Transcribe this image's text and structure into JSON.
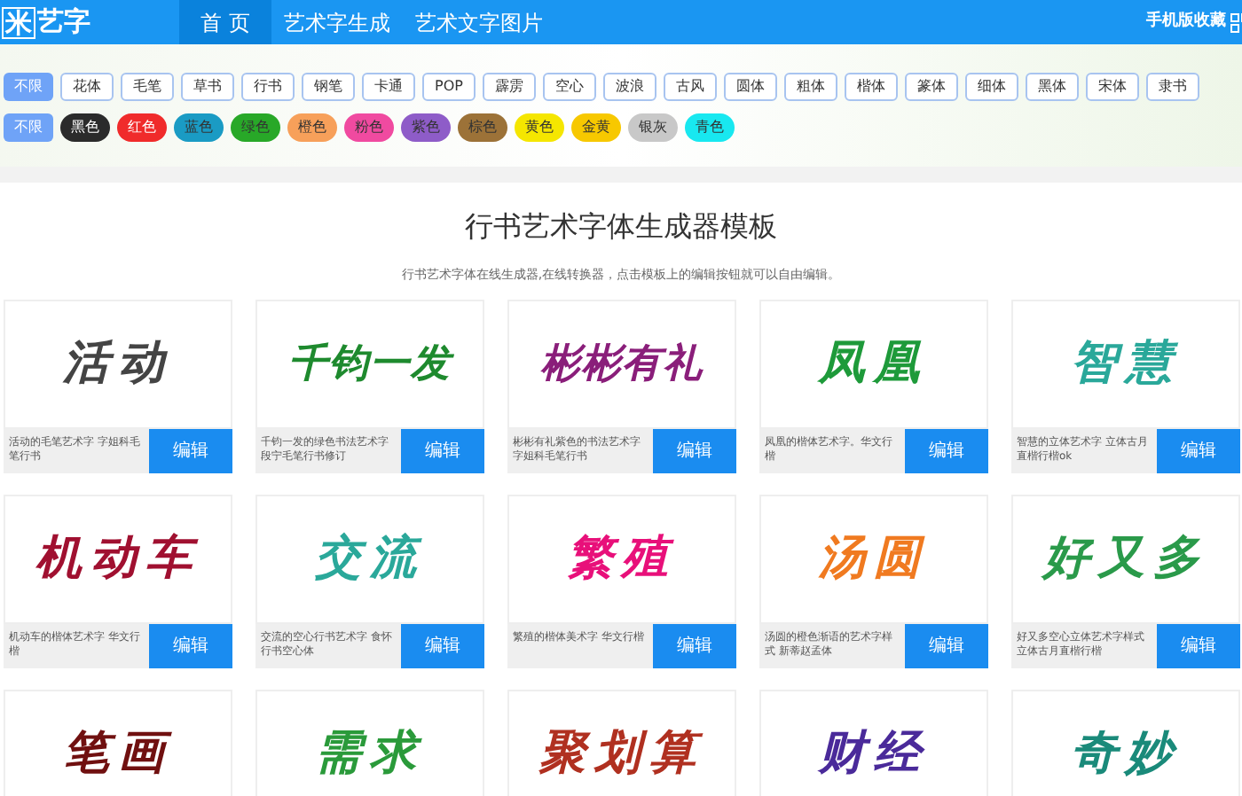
{
  "header": {
    "logo": "米艺字",
    "nav": [
      {
        "label": "首 页",
        "selected": true
      },
      {
        "label": "艺术字生成",
        "selected": false
      },
      {
        "label": "艺术文字图片",
        "selected": false
      }
    ],
    "mobile_link": "手机版收藏"
  },
  "font_filters": [
    {
      "label": "不限",
      "selected": true
    },
    {
      "label": "花体",
      "selected": false
    },
    {
      "label": "毛笔",
      "selected": false
    },
    {
      "label": "草书",
      "selected": false
    },
    {
      "label": "行书",
      "selected": false
    },
    {
      "label": "钢笔",
      "selected": false
    },
    {
      "label": "卡通",
      "selected": false
    },
    {
      "label": "POP",
      "selected": false
    },
    {
      "label": "霹雳",
      "selected": false
    },
    {
      "label": "空心",
      "selected": false
    },
    {
      "label": "波浪",
      "selected": false
    },
    {
      "label": "古风",
      "selected": false
    },
    {
      "label": "圆体",
      "selected": false
    },
    {
      "label": "粗体",
      "selected": false
    },
    {
      "label": "楷体",
      "selected": false
    },
    {
      "label": "篆体",
      "selected": false
    },
    {
      "label": "细体",
      "selected": false
    },
    {
      "label": "黑体",
      "selected": false
    },
    {
      "label": "宋体",
      "selected": false
    },
    {
      "label": "隶书",
      "selected": false
    }
  ],
  "color_filters": [
    {
      "label": "不限",
      "selected": true,
      "color": "#6fa3f7"
    },
    {
      "label": "黑色",
      "selected": false,
      "color": "#2b2b2b"
    },
    {
      "label": "红色",
      "selected": false,
      "color": "#f02b2b"
    },
    {
      "label": "蓝色",
      "selected": false,
      "color": "#1a9bc4"
    },
    {
      "label": "绿色",
      "selected": false,
      "color": "#28a828"
    },
    {
      "label": "橙色",
      "selected": false,
      "color": "#f7a05a"
    },
    {
      "label": "粉色",
      "selected": false,
      "color": "#f04aa0"
    },
    {
      "label": "紫色",
      "selected": false,
      "color": "#8e5cc8"
    },
    {
      "label": "棕色",
      "selected": false,
      "color": "#9c7238"
    },
    {
      "label": "黄色",
      "selected": false,
      "color": "#f5e600"
    },
    {
      "label": "金黄",
      "selected": false,
      "color": "#f7c800"
    },
    {
      "label": "银灰",
      "selected": false,
      "color": "#c8c8c8"
    },
    {
      "label": "青色",
      "selected": false,
      "color": "#18e8f0"
    }
  ],
  "title": "行书艺术字体生成器模板",
  "subtitle": "行书艺术字体在线生成器,在线转换器，点击模板上的编辑按钮就可以自由编辑。",
  "templates": [
    {
      "art": "活动",
      "color": "#444444",
      "caption": "活动的毛笔艺术字 字姐科毛笔行书",
      "button": "编辑"
    },
    {
      "art": "千钧一发",
      "color": "#1e8a2e",
      "caption": "千钧一发的绿色书法艺术字段宁毛笔行书修订",
      "button": "编辑"
    },
    {
      "art": "彬彬有礼",
      "color": "#8a1e7a",
      "caption": "彬彬有礼紫色的书法艺术字字姐科毛笔行书",
      "button": "编辑"
    },
    {
      "art": "凤凰",
      "color": "#1e9a3a",
      "caption": "凤凰的楷体艺术字。华文行楷",
      "button": "编辑"
    },
    {
      "art": "智慧",
      "color": "#2aa89a",
      "caption": "智慧的立体艺术字 立体古月直楷行楷ok",
      "button": "编辑"
    },
    {
      "art": "机动车",
      "color": "#a01030",
      "caption": "机动车的楷体艺术字 华文行楷",
      "button": "编辑"
    },
    {
      "art": "交流",
      "color": "#2aa89a",
      "caption": "交流的空心行书艺术字 食怀行书空心体",
      "button": "编辑"
    },
    {
      "art": "繁殖",
      "color": "#e8107a",
      "caption": "繁殖的楷体美术字 华文行楷",
      "button": "编辑"
    },
    {
      "art": "汤圆",
      "color": "#f07a20",
      "caption": "汤圆的橙色渐语的艺术字样式 新蒂赵孟体",
      "button": "编辑"
    },
    {
      "art": "好又多",
      "color": "#2a9a4a",
      "caption": "好又多空心立体艺术字样式立体古月直楷行楷",
      "button": "编辑"
    },
    {
      "art": "笔画",
      "color": "#701010"
    },
    {
      "art": "需求",
      "color": "#2a9a3a"
    },
    {
      "art": "聚划算",
      "color": "#b03020"
    },
    {
      "art": "财经",
      "color": "#4a2a9a"
    },
    {
      "art": "奇妙",
      "color": "#1a8a7a"
    }
  ]
}
